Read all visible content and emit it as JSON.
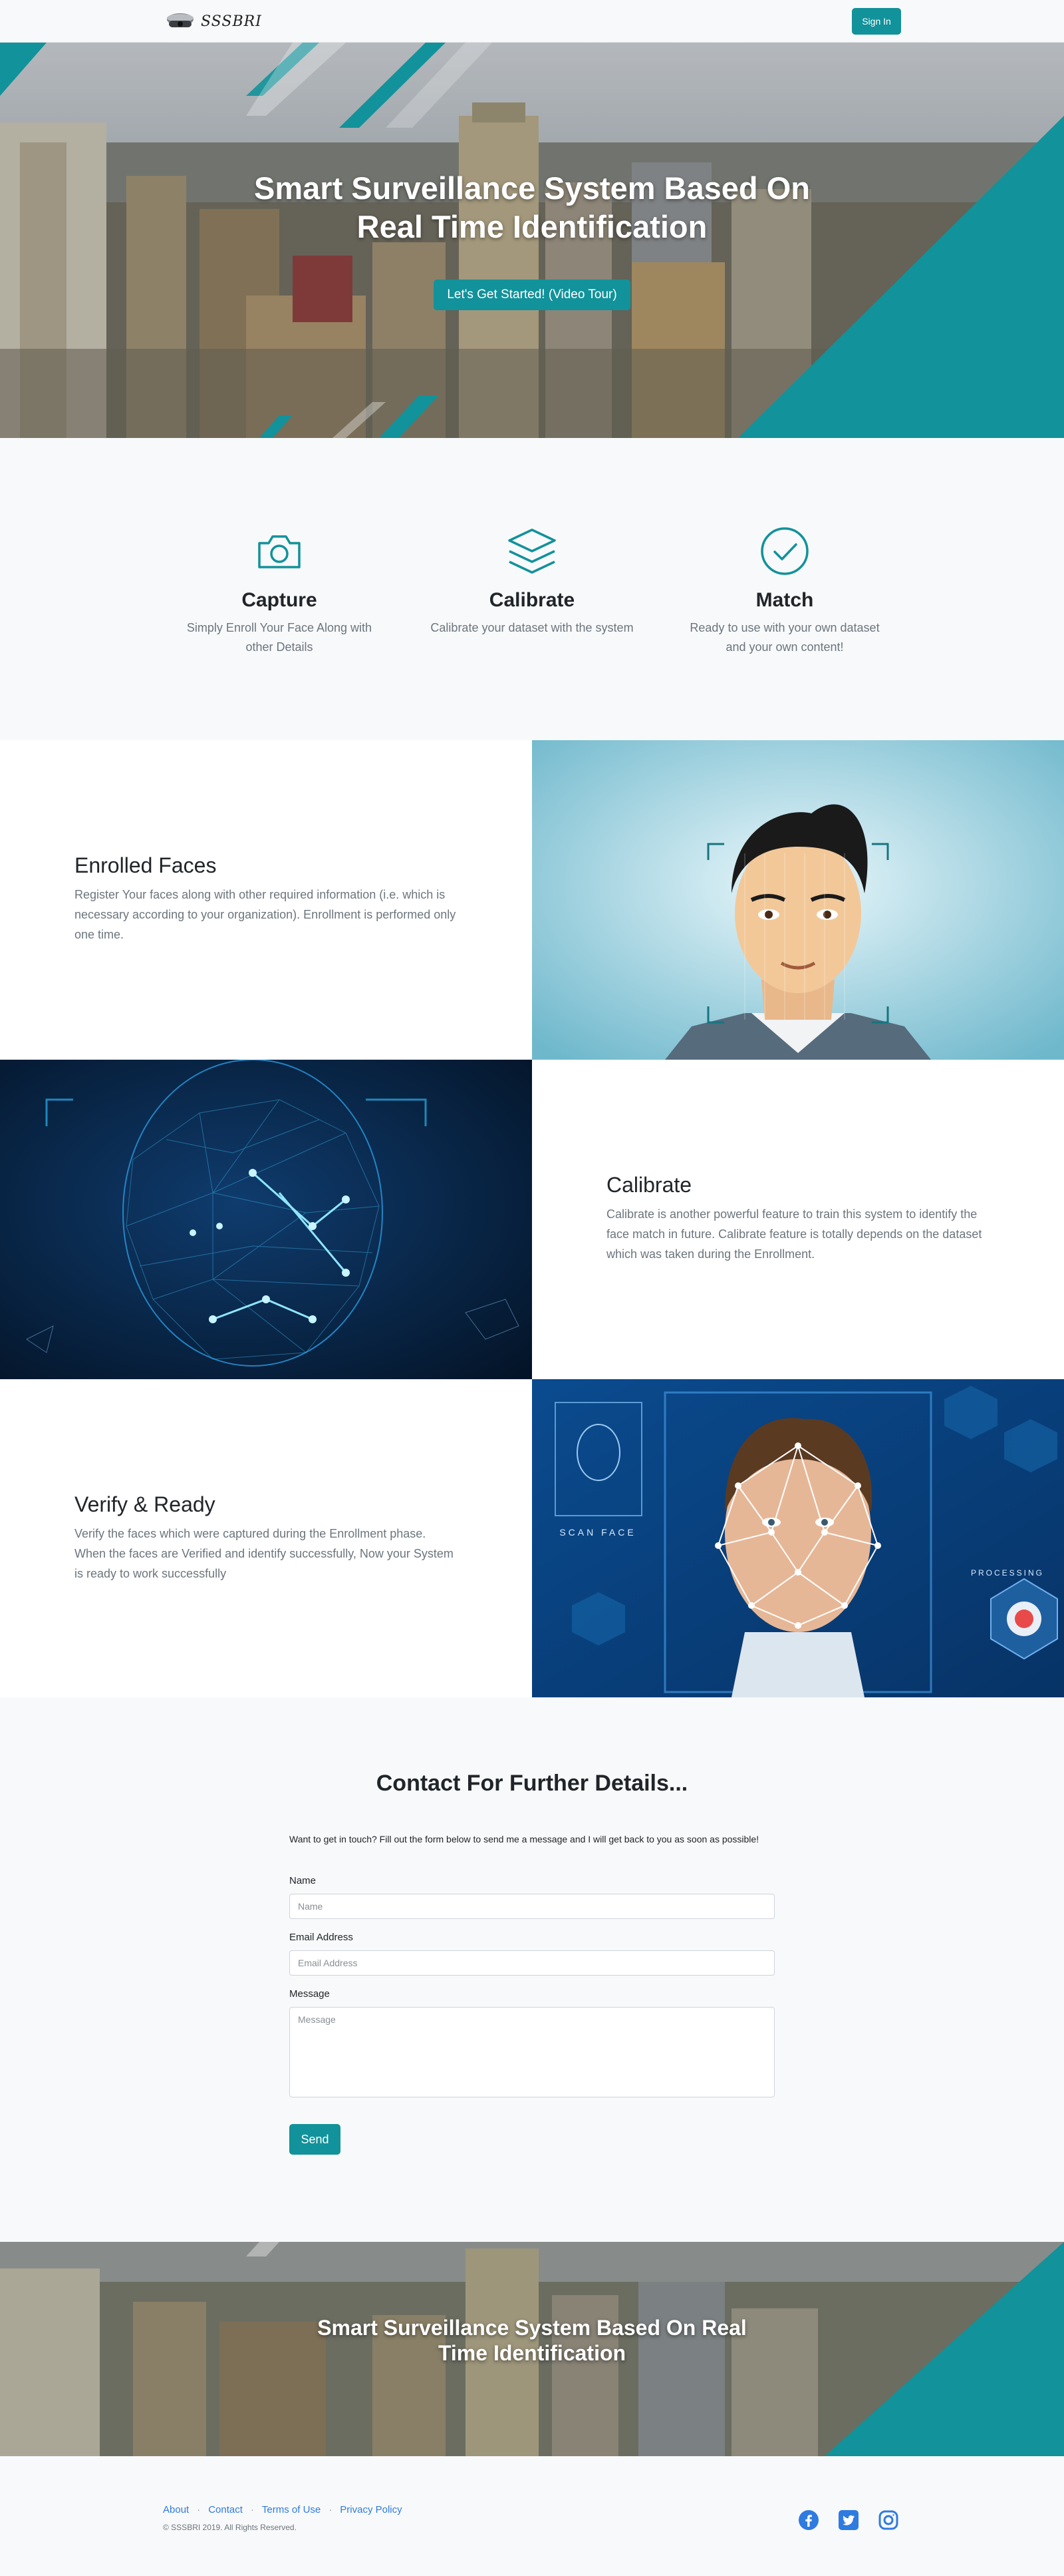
{
  "navbar": {
    "brand_text": "SSSBRI",
    "signin_label": "Sign In"
  },
  "hero": {
    "title": "Smart Surveillance System Based On Real Time Identification",
    "cta_label": "Let's Get Started! (Video Tour)"
  },
  "features": [
    {
      "icon": "camera-icon",
      "title": "Capture",
      "desc": "Simply Enroll Your Face Along with other Details"
    },
    {
      "icon": "layers-icon",
      "title": "Calibrate",
      "desc": "Calibrate your dataset with the system"
    },
    {
      "icon": "check-circle-icon",
      "title": "Match",
      "desc": "Ready to use with your own dataset and your own content!"
    }
  ],
  "showcases": [
    {
      "title": "Enrolled Faces",
      "desc": "Register Your faces along with other required information (i.e. which is necessary according to your organization). Enrollment is performed only one time.",
      "image": "cartoon-face-scan-image"
    },
    {
      "title": "Calibrate",
      "desc": "Calibrate is another powerful feature to train this system to identify the face match in future. Calibrate feature is totally depends on the dataset which was taken during the Enrollment.",
      "image": "wireframe-head-image"
    },
    {
      "title": "Verify & Ready",
      "desc": "Verify the faces which were captured during the Enrollment phase. When the faces are Verified and identify successfully, Now your System is ready to work successfully",
      "image": "face-recognition-scan-image"
    }
  ],
  "scan_overlay": {
    "scan_face_label": "SCAN FACE",
    "processing_label": "PROCESSING"
  },
  "contact": {
    "title": "Contact For Further Details...",
    "intro": "Want to get in touch? Fill out the form below to send me a message and I will get back to you as soon as possible!",
    "name_label": "Name",
    "name_placeholder": "Name",
    "email_label": "Email Address",
    "email_placeholder": "Email Address",
    "message_label": "Message",
    "message_placeholder": "Message",
    "send_label": "Send"
  },
  "cta": {
    "title": "Smart Surveillance System Based On Real Time Identification"
  },
  "footer": {
    "links": [
      "About",
      "Contact",
      "Terms of Use",
      "Privacy Policy"
    ],
    "separator": "·",
    "copyright": "© SSSBRI 2019. All Rights Reserved.",
    "social": [
      "facebook-icon",
      "twitter-icon",
      "instagram-icon"
    ]
  },
  "colors": {
    "accent": "#12929a",
    "link": "#2f7be0"
  }
}
